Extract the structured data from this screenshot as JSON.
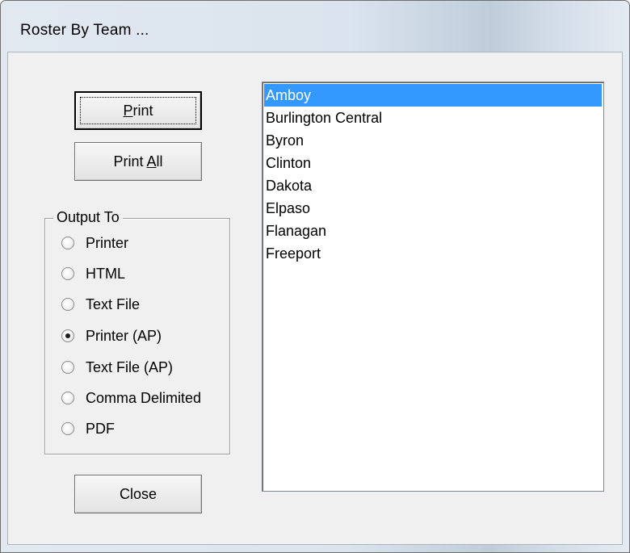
{
  "window": {
    "title": "Roster By Team ..."
  },
  "buttons": {
    "print_label": "Print",
    "print_accel": "P",
    "print_rest": "rint",
    "printall_pre": "Print ",
    "printall_accel": "A",
    "printall_rest": "ll",
    "close_label": "Close"
  },
  "output": {
    "label": "Output To",
    "options": [
      {
        "label": "Printer",
        "checked": false
      },
      {
        "label": "HTML",
        "checked": false
      },
      {
        "label": "Text File",
        "checked": false
      },
      {
        "label": "Printer (AP)",
        "checked": true
      },
      {
        "label": "Text File (AP)",
        "checked": false
      },
      {
        "label": "Comma Delimited",
        "checked": false
      },
      {
        "label": "PDF",
        "checked": false
      }
    ]
  },
  "teams": {
    "items": [
      {
        "label": "Amboy",
        "selected": true
      },
      {
        "label": "Burlington Central",
        "selected": false
      },
      {
        "label": "Byron",
        "selected": false
      },
      {
        "label": "Clinton",
        "selected": false
      },
      {
        "label": "Dakota",
        "selected": false
      },
      {
        "label": "Elpaso",
        "selected": false
      },
      {
        "label": "Flanagan",
        "selected": false
      },
      {
        "label": "Freeport",
        "selected": false
      }
    ],
    "selected_color": "#3399ff"
  }
}
